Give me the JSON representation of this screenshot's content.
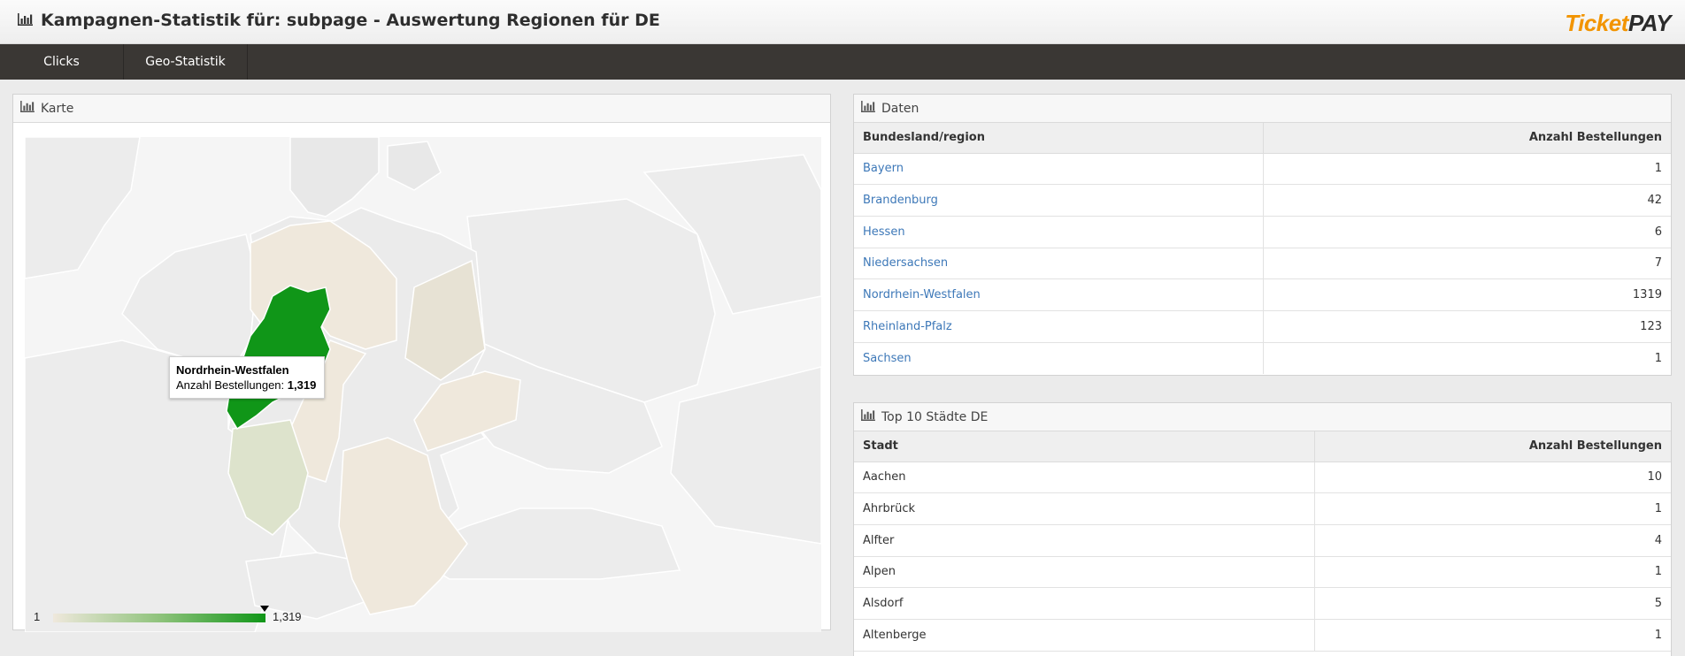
{
  "header": {
    "title": "Kampagnen-Statistik für: subpage - Auswertung Regionen für DE",
    "logo_ticket": "Ticket",
    "logo_pay": "PAY"
  },
  "nav": {
    "items": [
      {
        "label": "Clicks"
      },
      {
        "label": "Geo-Statistik"
      }
    ]
  },
  "map_panel": {
    "title": "Karte",
    "tooltip": {
      "region": "Nordrhein-Westfalen",
      "label": "Anzahl Bestellungen:",
      "value": "1,319"
    },
    "legend": {
      "min": "1",
      "max": "1,319"
    },
    "colors": {
      "max": "#109618",
      "mid": "#dde3cc",
      "min": "#efe8dc",
      "background": "#f5f5f5"
    }
  },
  "data_panel": {
    "title": "Daten",
    "columns": [
      "Bundesland/region",
      "Anzahl Bestellungen"
    ],
    "rows": [
      {
        "name": "Bayern",
        "count": "1"
      },
      {
        "name": "Brandenburg",
        "count": "42"
      },
      {
        "name": "Hessen",
        "count": "6"
      },
      {
        "name": "Niedersachsen",
        "count": "7"
      },
      {
        "name": "Nordrhein-Westfalen",
        "count": "1319"
      },
      {
        "name": "Rheinland-Pfalz",
        "count": "123"
      },
      {
        "name": "Sachsen",
        "count": "1"
      }
    ]
  },
  "cities_panel": {
    "title": "Top 10 Städte DE",
    "columns": [
      "Stadt",
      "Anzahl Bestellungen"
    ],
    "rows": [
      {
        "name": "Aachen",
        "count": "10"
      },
      {
        "name": "Ahrbrück",
        "count": "1"
      },
      {
        "name": "Alfter",
        "count": "4"
      },
      {
        "name": "Alpen",
        "count": "1"
      },
      {
        "name": "Alsdorf",
        "count": "5"
      },
      {
        "name": "Altenberge",
        "count": "1"
      }
    ]
  }
}
